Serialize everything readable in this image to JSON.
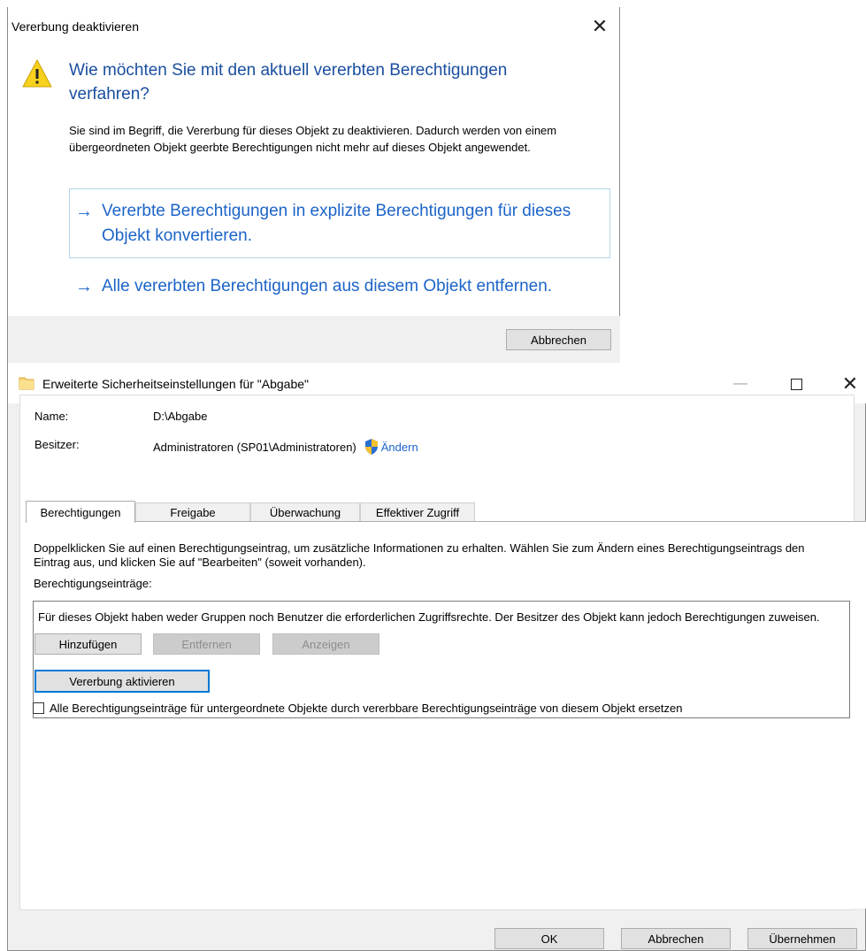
{
  "dialog": {
    "title": "Vererbung deaktivieren",
    "main_instruction": "Wie möchten Sie mit den aktuell vererbten Berechtigungen verfahren?",
    "content": "Sie sind im Begriff, die Vererbung für dieses Objekt zu deaktivieren. Dadurch werden von einem übergeordneten Objekt geerbte Berechtigungen nicht mehr auf dieses Objekt angewendet.",
    "option_convert": "Vererbte Berechtigungen in explizite Berechtigungen für dieses Objekt konvertieren.",
    "option_remove": "Alle vererbten Berechtigungen aus diesem Objekt entfernen.",
    "arrow": "→",
    "cancel_label": "Abbrechen",
    "close_glyph": "✕"
  },
  "window": {
    "title": "Erweiterte Sicherheitseinstellungen für \"Abgabe\"",
    "min_glyph": "—",
    "close_glyph": "✕",
    "name_label": "Name:",
    "name_value": "D:\\Abgabe",
    "owner_label": "Besitzer:",
    "owner_value": "Administratoren (SP01\\Administratoren)",
    "owner_change": "Ändern",
    "tabs": [
      "Berechtigungen",
      "Freigabe",
      "Überwachung",
      "Effektiver Zugriff"
    ],
    "description": "Doppelklicken Sie auf einen Berechtigungseintrag, um zusätzliche Informationen zu erhalten. Wählen Sie zum Ändern eines Berechtigungseintrags den Eintrag aus, und klicken Sie auf \"Bearbeiten\" (soweit vorhanden).",
    "entries_label": "Berechtigungseinträge:",
    "entries_message": "Für dieses Objekt haben weder Gruppen noch Benutzer die erforderlichen Zugriffsrechte. Der Besitzer des Objekt kann jedoch Berechtigungen zuweisen.",
    "add_label": "Hinzufügen",
    "remove_label": "Entfernen",
    "view_label": "Anzeigen",
    "enable_inheritance_label": "Vererbung aktivieren",
    "replace_checkbox_label": "Alle Berechtigungseinträge für untergeordnete Objekte durch vererbbare Berechtigungseinträge von diesem Objekt ersetzen",
    "replace_checked": false,
    "ok_label": "OK",
    "cancel_label": "Abbrechen",
    "apply_label": "Übernehmen"
  },
  "colors": {
    "link_blue": "#1c64c8",
    "instruction_blue": "#1a4e9f",
    "warning_yellow": "#f8d11e",
    "focus_blue": "#0078d7"
  }
}
